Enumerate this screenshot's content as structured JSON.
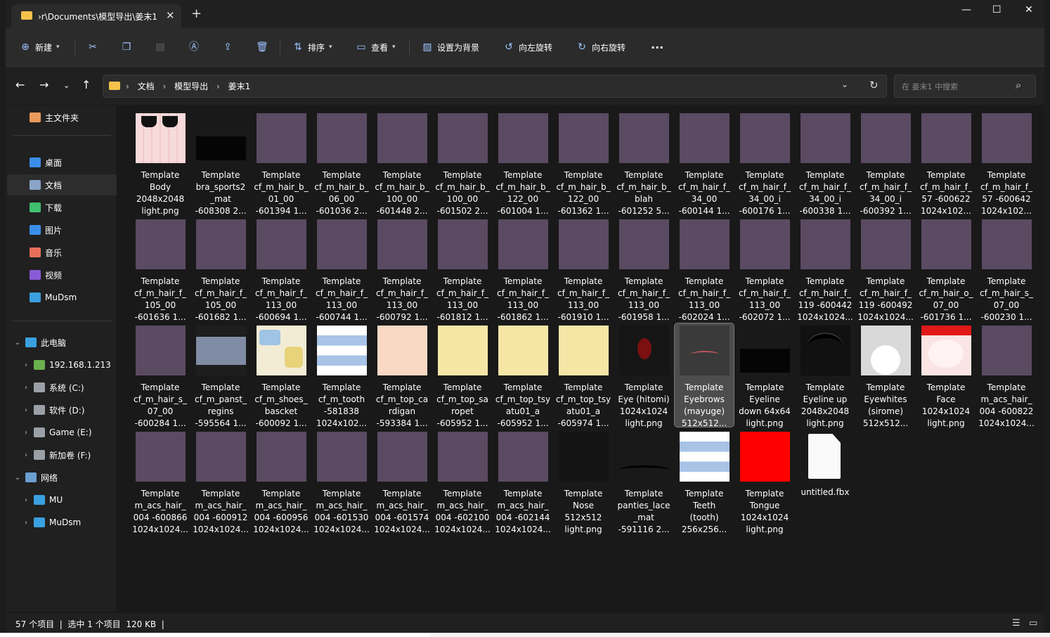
{
  "tab": {
    "title": "›r\\Documents\\模型导出\\姜末1",
    "close": "✕",
    "new": "+"
  },
  "window_controls": {
    "minimize": "—",
    "maximize": "☐",
    "close": "✕"
  },
  "toolbar": {
    "new": "新建",
    "sort": "排序",
    "view": "查看",
    "set_background": "设置为背景",
    "rotate_left": "向左旋转",
    "rotate_right": "向右旋转",
    "more": "···"
  },
  "nav": {
    "breadcrumbs": [
      "文档",
      "模型导出",
      "姜末1"
    ],
    "search_placeholder": "在 姜末1 中搜索"
  },
  "sidebar": {
    "home": "主文件夹",
    "quick": [
      {
        "label": "桌面",
        "color": "#3b8ee8"
      },
      {
        "label": "文档",
        "color": "#8aa5c8"
      },
      {
        "label": "下载",
        "color": "#3fbf6f"
      },
      {
        "label": "图片",
        "color": "#3b8ee8"
      },
      {
        "label": "音乐",
        "color": "#e8705a"
      },
      {
        "label": "视频",
        "color": "#8a5bd6"
      },
      {
        "label": "MuDsm",
        "color": "#3aa0e0"
      }
    ],
    "this_pc": "此电脑",
    "drives": [
      "192.168.1.213",
      "系统 (C:)",
      "软件 (D:)",
      "Game (E:)",
      "新加卷 (F:)"
    ],
    "network": "网络",
    "network_items": [
      "MU",
      "MuDsm"
    ]
  },
  "files": [
    {
      "name": "Template\nBody\n2048x2048\nlight.png",
      "thumb": "body"
    },
    {
      "name": "Template\nbra_sports2\n_mat\n-608308 2...",
      "thumb": "black"
    },
    {
      "name": "Template\ncf_m_hair_b_\n01_00\n-601394 1...",
      "thumb": "purple"
    },
    {
      "name": "Template\ncf_m_hair_b_\n06_00\n-601036 2...",
      "thumb": "purple"
    },
    {
      "name": "Template\ncf_m_hair_b_\n100_00\n-601448 2...",
      "thumb": "purple"
    },
    {
      "name": "Template\ncf_m_hair_b_\n100_00\n-601502 2...",
      "thumb": "purple"
    },
    {
      "name": "Template\ncf_m_hair_b_\n122_00\n-601004 1...",
      "thumb": "purple"
    },
    {
      "name": "Template\ncf_m_hair_b_\n122_00\n-601362 1...",
      "thumb": "purple"
    },
    {
      "name": "Template\ncf_m_hair_b_\nblah\n-601252 5...",
      "thumb": "purple"
    },
    {
      "name": "Template\ncf_m_hair_f_\n34_00\n-600144 1...",
      "thumb": "purple"
    },
    {
      "name": "Template\ncf_m_hair_f_\n34_00_i\n-600176 1...",
      "thumb": "purple"
    },
    {
      "name": "Template\ncf_m_hair_f_\n34_00_i\n-600338 1...",
      "thumb": "purple"
    },
    {
      "name": "Template\ncf_m_hair_f_\n34_00_i\n-600392 1...",
      "thumb": "purple"
    },
    {
      "name": "Template\ncf_m_hair_f_\n57 -600622\n1024x102...",
      "thumb": "purple"
    },
    {
      "name": "Template\ncf_m_hair_f_\n57 -600642\n1024x102...",
      "thumb": "purple"
    },
    {
      "name": "Template\ncf_m_hair_f_\n105_00\n-601636 1...",
      "thumb": "purple"
    },
    {
      "name": "Template\ncf_m_hair_f_\n105_00\n-601682 1...",
      "thumb": "purple"
    },
    {
      "name": "Template\ncf_m_hair_f_\n113_00\n-600694 1...",
      "thumb": "purple"
    },
    {
      "name": "Template\ncf_m_hair_f_\n113_00\n-600744 1...",
      "thumb": "purple"
    },
    {
      "name": "Template\ncf_m_hair_f_\n113_00\n-600792 1...",
      "thumb": "purple"
    },
    {
      "name": "Template\ncf_m_hair_f_\n113_00\n-601812 1...",
      "thumb": "purple"
    },
    {
      "name": "Template\ncf_m_hair_f_\n113_00\n-601862 1...",
      "thumb": "purple"
    },
    {
      "name": "Template\ncf_m_hair_f_\n113_00\n-601910 1...",
      "thumb": "purple"
    },
    {
      "name": "Template\ncf_m_hair_f_\n113_00\n-601958 1...",
      "thumb": "purple"
    },
    {
      "name": "Template\ncf_m_hair_f_\n113_00\n-602024 1...",
      "thumb": "purple"
    },
    {
      "name": "Template\ncf_m_hair_f_\n113_00\n-602072 1...",
      "thumb": "purple"
    },
    {
      "name": "Template\ncf_m_hair_f_\n119 -600442\n1024x1024...",
      "thumb": "purple"
    },
    {
      "name": "Template\ncf_m_hair_f_\n119 -600492\n1024x1024...",
      "thumb": "purple"
    },
    {
      "name": "Template\ncf_m_hair_o_\n07_00\n-601736 1...",
      "thumb": "purple"
    },
    {
      "name": "Template\ncf_m_hair_s_\n07_00\n-600230 1...",
      "thumb": "purple"
    },
    {
      "name": "Template\ncf_m_hair_s_\n07_00\n-600284 1...",
      "thumb": "purple"
    },
    {
      "name": "Template\ncf_m_panst_\nregins\n-595564 1...",
      "thumb": "panst"
    },
    {
      "name": "Template\ncf_m_shoes_\nbascket\n-600092 1...",
      "thumb": "shoes"
    },
    {
      "name": "Template\ncf_m_tooth\n-581838\n1024x102...",
      "thumb": "tooth"
    },
    {
      "name": "Template\ncf_m_top_ca\nrdigan\n-593384 1...",
      "thumb": "peach"
    },
    {
      "name": "Template\ncf_m_top_sa\nropet\n-605952 1...",
      "thumb": "yellow"
    },
    {
      "name": "Template\ncf_m_top_tsy\natu01_a\n-605952 1...",
      "thumb": "yellow"
    },
    {
      "name": "Template\ncf_m_top_tsy\natu01_a\n-605974 1...",
      "thumb": "yellow"
    },
    {
      "name": "Template\nEye (hitomi)\n1024x1024\nlight.png",
      "thumb": "eye"
    },
    {
      "name": "Template\nEyebrows\n(mayuge)\n512x512...",
      "thumb": "brow",
      "selected": true
    },
    {
      "name": "Template\nEyeline\ndown 64x64\nlight.png",
      "thumb": "black"
    },
    {
      "name": "Template\nEyeline up\n2048x2048\nlight.png",
      "thumb": "lineup"
    },
    {
      "name": "Template\nEyewhites\n(sirome)\n512x512...",
      "thumb": "white"
    },
    {
      "name": "Template\nFace\n1024x1024\nlight.png",
      "thumb": "face"
    },
    {
      "name": "Template\nm_acs_hair_\n004 -600822\n1024x1024...",
      "thumb": "purple"
    },
    {
      "name": "Template\nm_acs_hair_\n004 -600866\n1024x1024...",
      "thumb": "purple"
    },
    {
      "name": "Template\nm_acs_hair_\n004 -600912\n1024x1024...",
      "thumb": "purple"
    },
    {
      "name": "Template\nm_acs_hair_\n004 -600956\n1024x1024...",
      "thumb": "purple"
    },
    {
      "name": "Template\nm_acs_hair_\n004 -601530\n1024x1024...",
      "thumb": "purple"
    },
    {
      "name": "Template\nm_acs_hair_\n004 -601574\n1024x1024...",
      "thumb": "purple"
    },
    {
      "name": "Template\nm_acs_hair_\n004 -602100\n1024x1024...",
      "thumb": "purple"
    },
    {
      "name": "Template\nm_acs_hair_\n004 -602144\n1024x1024...",
      "thumb": "purple"
    },
    {
      "name": "Template\nNose\n512x512\nlight.png",
      "thumb": "nose"
    },
    {
      "name": "Template\npanties_lace\n_mat\n-591116 2...",
      "thumb": "panties"
    },
    {
      "name": "Template\nTeeth\n(tooth)\n256x256...",
      "thumb": "tooth"
    },
    {
      "name": "Template\nTongue\n1024x1024\nlight.png",
      "thumb": "red"
    },
    {
      "name": "untitled.fbx",
      "thumb": "doc"
    }
  ],
  "status": {
    "count": "57 个项目",
    "selected": "选中 1 个项目",
    "size": "120 KB"
  },
  "colors": {
    "accent": "#9dc3ff",
    "thumb_purple": "#5a4a62",
    "folder": "#f5c14b"
  }
}
